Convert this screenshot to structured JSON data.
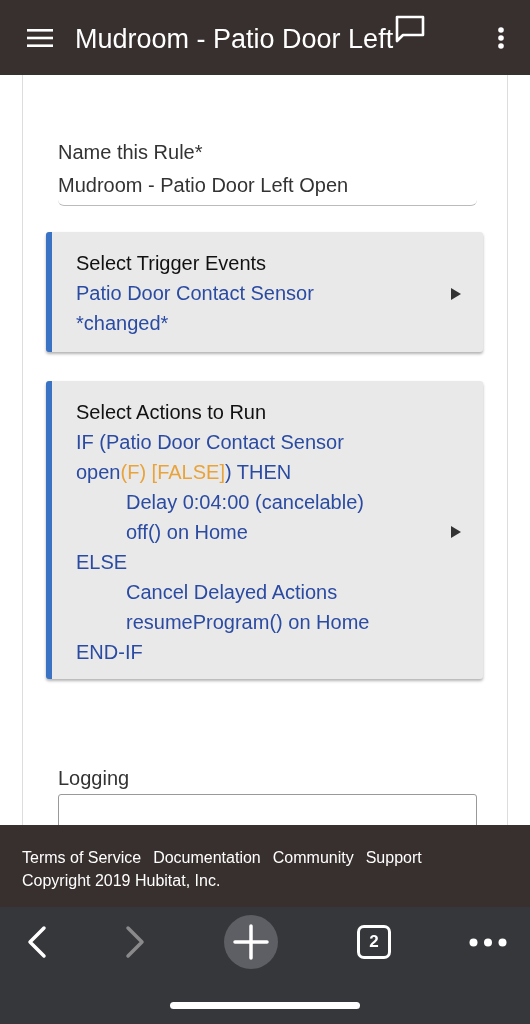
{
  "header": {
    "title": "Mudroom - Patio Door Left"
  },
  "name_field": {
    "label": "Name this Rule*",
    "value": "Mudroom - Patio Door Left Open"
  },
  "trigger_card": {
    "title": "Select Trigger Events",
    "lines": [
      "Patio Door Contact Sensor",
      "*changed*"
    ]
  },
  "actions_card": {
    "title": "Select Actions to Run",
    "lines": [
      {
        "kind": "plain",
        "parts": [
          {
            "text": "IF (Patio Door Contact Sensor",
            "kind": "text"
          }
        ]
      },
      {
        "kind": "plain",
        "parts": [
          {
            "text": "open",
            "kind": "text"
          },
          {
            "text": "(F) [FALSE]",
            "kind": "eval"
          },
          {
            "text": ") THEN",
            "kind": "text"
          }
        ]
      },
      {
        "kind": "indented",
        "parts": [
          {
            "text": "Delay 0:04:00 (cancelable)",
            "kind": "text"
          }
        ]
      },
      {
        "kind": "indented",
        "parts": [
          {
            "text": "off() on Home",
            "kind": "text"
          }
        ]
      },
      {
        "kind": "plain",
        "parts": [
          {
            "text": "ELSE",
            "kind": "text"
          }
        ]
      },
      {
        "kind": "indented",
        "parts": [
          {
            "text": "Cancel Delayed Actions",
            "kind": "text"
          }
        ]
      },
      {
        "kind": "indented",
        "parts": [
          {
            "text": "resumeProgram() on Home",
            "kind": "text"
          }
        ]
      },
      {
        "kind": "plain",
        "parts": [
          {
            "text": "END-IF",
            "kind": "text"
          }
        ]
      }
    ]
  },
  "logging": {
    "label": "Logging"
  },
  "footer": {
    "links": [
      "Terms of Service",
      "Documentation",
      "Community",
      "Support"
    ],
    "copyright": "Copyright 2019 Hubitat, Inc."
  },
  "browser_bar": {
    "back": {
      "disabled": false
    },
    "forward": {
      "disabled": true
    },
    "tab_count": "2"
  }
}
